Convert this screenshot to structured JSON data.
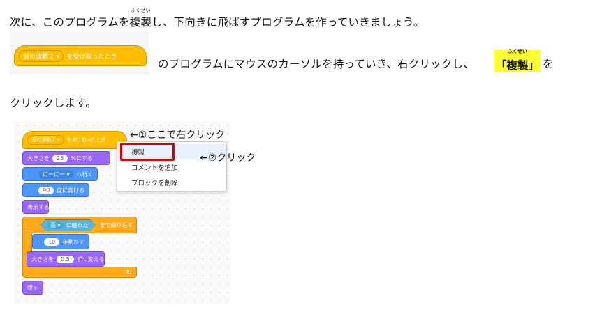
{
  "line1": {
    "before": "次に、このプログラムを",
    "ruby_word": "複製",
    "ruby": "ふくせい",
    "after": "し、下向きに飛ばすプログラムを作っていきましょう。"
  },
  "line2": {
    "block": {
      "dropdown": "音の波動２ ▾",
      "label": "を受け取ったとき"
    },
    "text_before": "のプログラムにマウスのカーソルを持っていき、右クリックし、",
    "highlight": "「複製」",
    "highlight_ruby": "ふくせい",
    "text_after": "を"
  },
  "line3": {
    "text": "クリックします。"
  },
  "screenshot": {
    "hat_block": {
      "dropdown": "音の波動２ ▾",
      "label": "を受け取ったとき"
    },
    "blocks": {
      "size_set": {
        "prefix": "大きさを",
        "value": "25",
        "suffix": "%にする"
      },
      "goto": {
        "dropdown": "にーにー ▾",
        "suffix": "へ行く"
      },
      "point": {
        "value": "90",
        "suffix": "度に向ける"
      },
      "show": {
        "label": "表示する"
      },
      "repeat": {
        "sensor": "雨 ▾",
        "sensor_label": "に触れた",
        "suffix": "まで繰り返す"
      },
      "move": {
        "value": "10",
        "suffix": "歩動かす"
      },
      "size_change": {
        "prefix": "大きさを",
        "value": "0.5",
        "suffix": "ずつ変える"
      },
      "loop_arrow": "↻",
      "hide": {
        "label": "隠す"
      }
    },
    "context_menu": {
      "items": [
        "複製",
        "コメントを追加",
        "ブロックを削除"
      ]
    },
    "annotations": {
      "step1": "←①ここで右クリック",
      "step2": "←②クリック"
    }
  },
  "colors": {
    "events": "#ffbf00",
    "looks": "#9966ff",
    "motion": "#4c97ff",
    "control": "#ffab19",
    "sensing": "#5cb1d6",
    "highlight": "#ffff33",
    "callout_border": "#dd0000"
  }
}
